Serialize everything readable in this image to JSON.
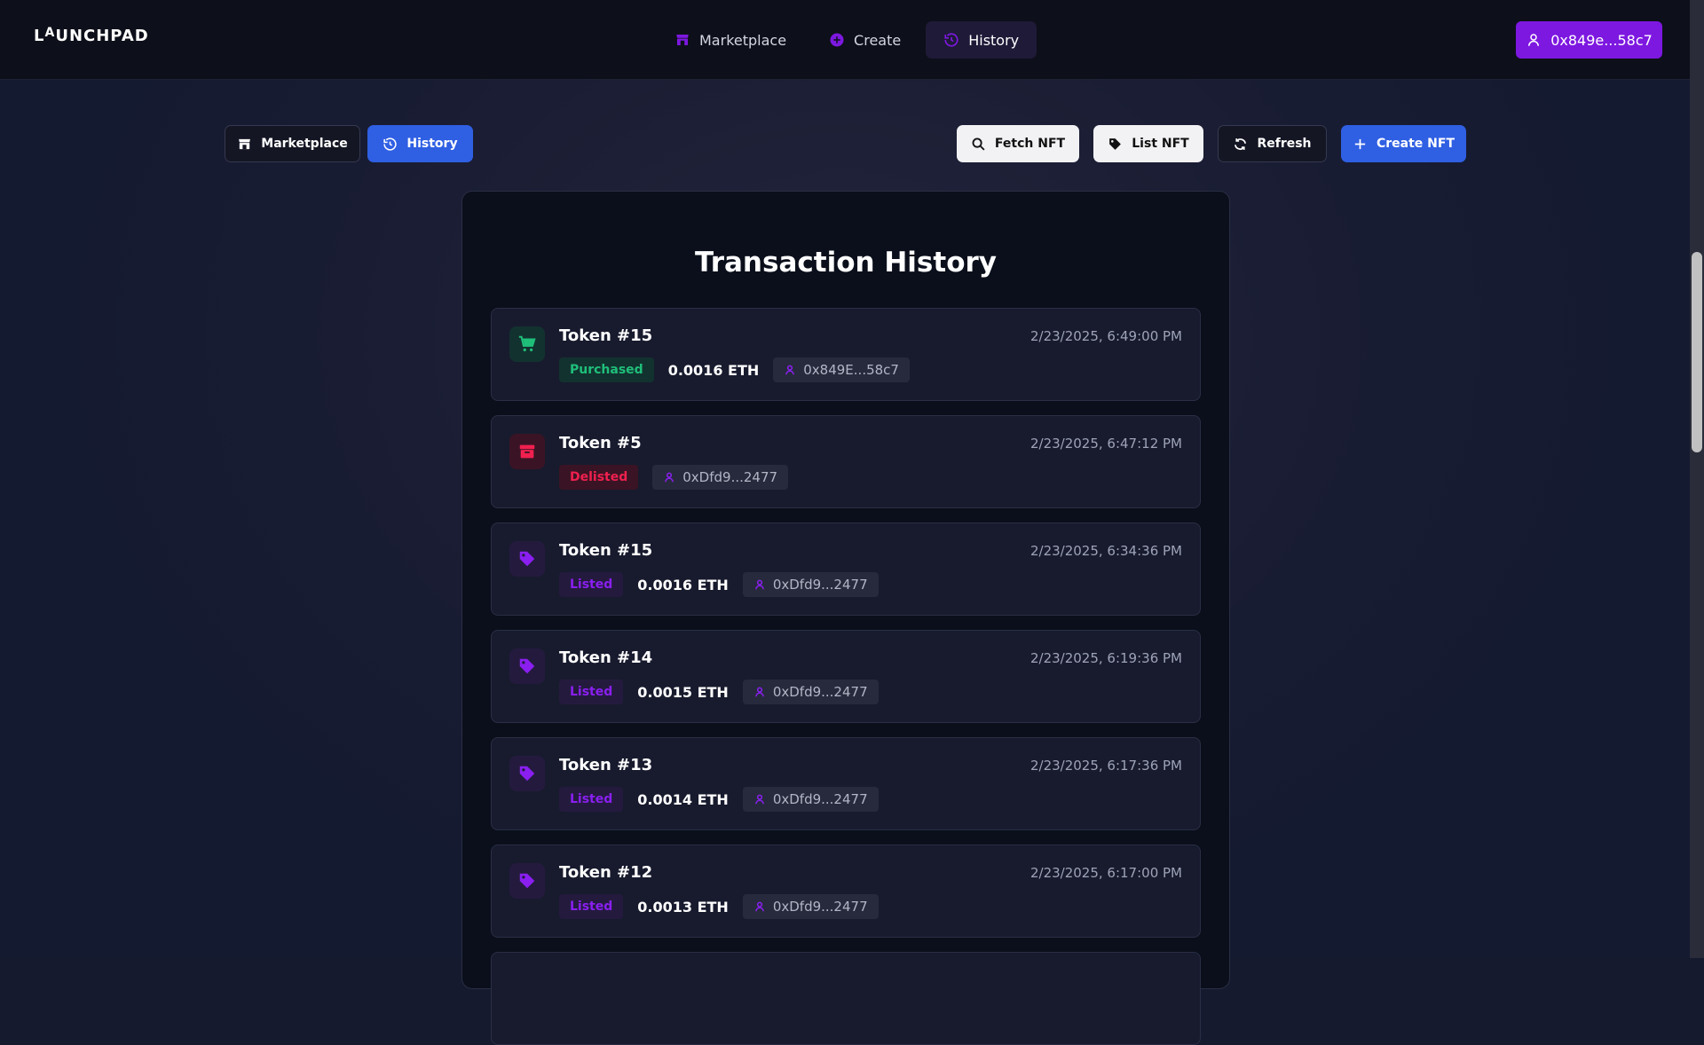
{
  "app": {
    "logo_left": "L",
    "logo_up": "A",
    "logo_rest": "UNCHPAD"
  },
  "nav": {
    "items": [
      {
        "label": "Marketplace",
        "icon": "store-icon"
      },
      {
        "label": "Create",
        "icon": "plus-circle-icon"
      },
      {
        "label": "History",
        "icon": "history-icon",
        "active": true
      }
    ]
  },
  "wallet": {
    "address": "0x849e...58c7",
    "icon": "user-icon"
  },
  "toolbar": {
    "marketplace_label": "Marketplace",
    "history_label": "History",
    "fetch_label": "Fetch NFT",
    "list_label": "List NFT",
    "refresh_label": "Refresh",
    "create_label": "Create NFT"
  },
  "panel": {
    "title": "Transaction History",
    "transactions": [
      {
        "token": "Token #15",
        "status": "Purchased",
        "price": "0.0016 ETH",
        "address": "0x849E...58c7",
        "date": "2/23/2025, 6:49:00 PM",
        "icon": "cart-icon"
      },
      {
        "token": "Token #5",
        "status": "Delisted",
        "price": "",
        "address": "0xDfd9...2477",
        "date": "2/23/2025, 6:47:12 PM",
        "icon": "archive-icon"
      },
      {
        "token": "Token #15",
        "status": "Listed",
        "price": "0.0016 ETH",
        "address": "0xDfd9...2477",
        "date": "2/23/2025, 6:34:36 PM",
        "icon": "tag-icon"
      },
      {
        "token": "Token #14",
        "status": "Listed",
        "price": "0.0015 ETH",
        "address": "0xDfd9...2477",
        "date": "2/23/2025, 6:19:36 PM",
        "icon": "tag-icon"
      },
      {
        "token": "Token #13",
        "status": "Listed",
        "price": "0.0014 ETH",
        "address": "0xDfd9...2477",
        "date": "2/23/2025, 6:17:36 PM",
        "icon": "tag-icon"
      },
      {
        "token": "Token #12",
        "status": "Listed",
        "price": "0.0013 ETH",
        "address": "0xDfd9...2477",
        "date": "2/23/2025, 6:17:00 PM",
        "icon": "tag-icon"
      }
    ]
  },
  "colors": {
    "accent_purple": "#7d18e0",
    "accent_blue": "#2f5fe3",
    "status_purchased": "#1fbf7a",
    "status_delisted": "#f0204f",
    "status_listed": "#8a1ff0"
  }
}
